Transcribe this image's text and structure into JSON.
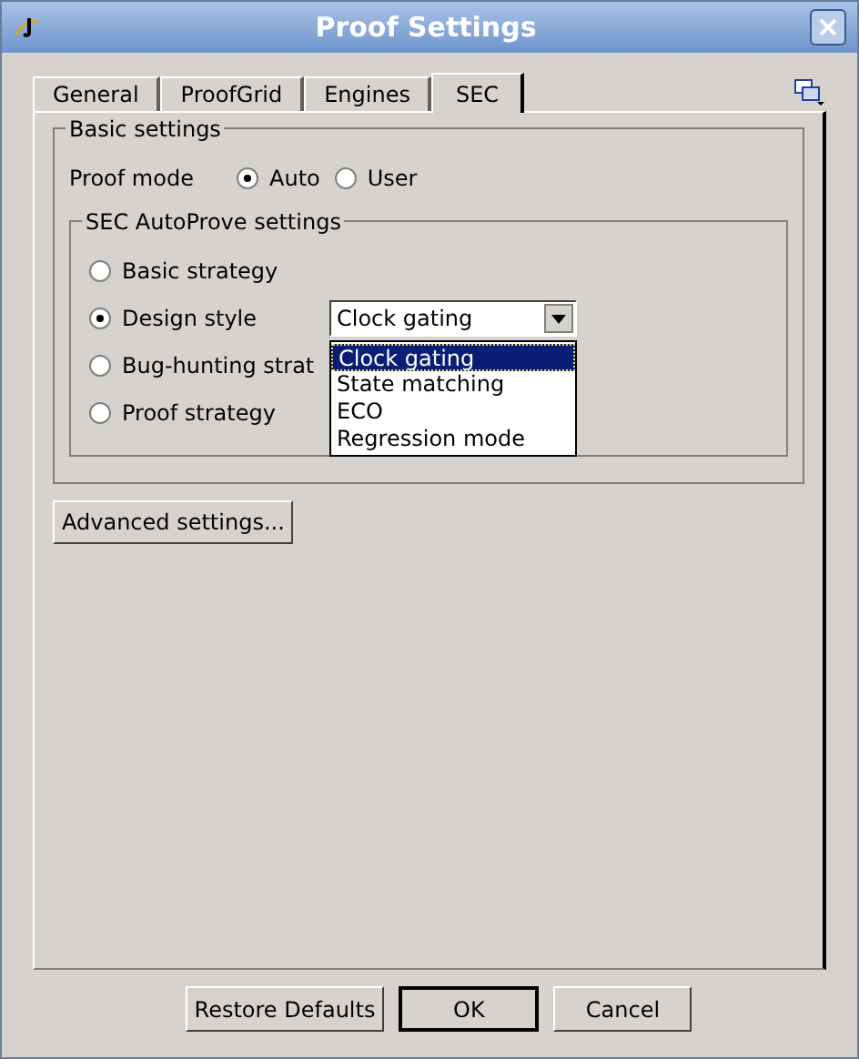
{
  "window": {
    "title": "Proof Settings"
  },
  "tabs": [
    {
      "label": "General",
      "selected": false
    },
    {
      "label": "ProofGrid",
      "selected": false
    },
    {
      "label": "Engines",
      "selected": false
    },
    {
      "label": "SEC",
      "selected": true
    }
  ],
  "basic_settings": {
    "title": "Basic settings",
    "proof_mode": {
      "label": "Proof mode",
      "options": [
        {
          "label": "Auto",
          "selected": true
        },
        {
          "label": "User",
          "selected": false
        }
      ]
    }
  },
  "autoprove": {
    "title": "SEC AutoProve settings",
    "strategies": [
      {
        "label": "Basic strategy",
        "selected": false
      },
      {
        "label": "Design style",
        "selected": true
      },
      {
        "label": "Bug-hunting strat",
        "selected": false
      },
      {
        "label": "Proof strategy",
        "selected": false
      }
    ],
    "design_style": {
      "value": "Clock gating",
      "expanded": true,
      "options": [
        {
          "label": "Clock gating",
          "selected": true
        },
        {
          "label": "State matching",
          "selected": false
        },
        {
          "label": "ECO",
          "selected": false
        },
        {
          "label": "Regression mode",
          "selected": false
        }
      ]
    }
  },
  "advanced_button": "Advanced settings...",
  "buttons": [
    "Restore Defaults",
    "OK",
    "Cancel"
  ]
}
